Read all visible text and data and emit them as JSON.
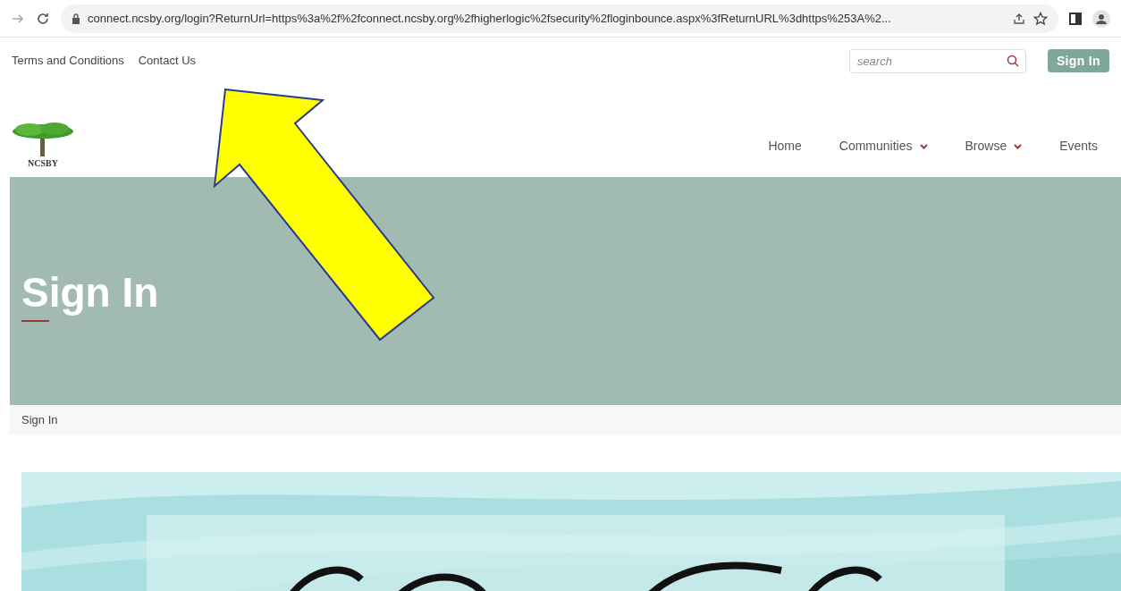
{
  "browser": {
    "url": "connect.ncsby.org/login?ReturnUrl=https%3a%2f%2fconnect.ncsby.org%2fhigherlogic%2fsecurity%2floginbounce.aspx%3fReturnURL%3dhttps%253A%2..."
  },
  "utility_links": [
    "Terms and Conditions",
    "Contact Us"
  ],
  "search": {
    "placeholder": "search"
  },
  "sign_in_button": "Sign In",
  "logo": {
    "text": "NCSBY"
  },
  "nav": [
    {
      "label": "Home",
      "dropdown": false
    },
    {
      "label": "Communities",
      "dropdown": true
    },
    {
      "label": "Browse",
      "dropdown": true
    },
    {
      "label": "Events",
      "dropdown": false
    }
  ],
  "hero": {
    "title": "Sign In"
  },
  "breadcrumb": "Sign In"
}
